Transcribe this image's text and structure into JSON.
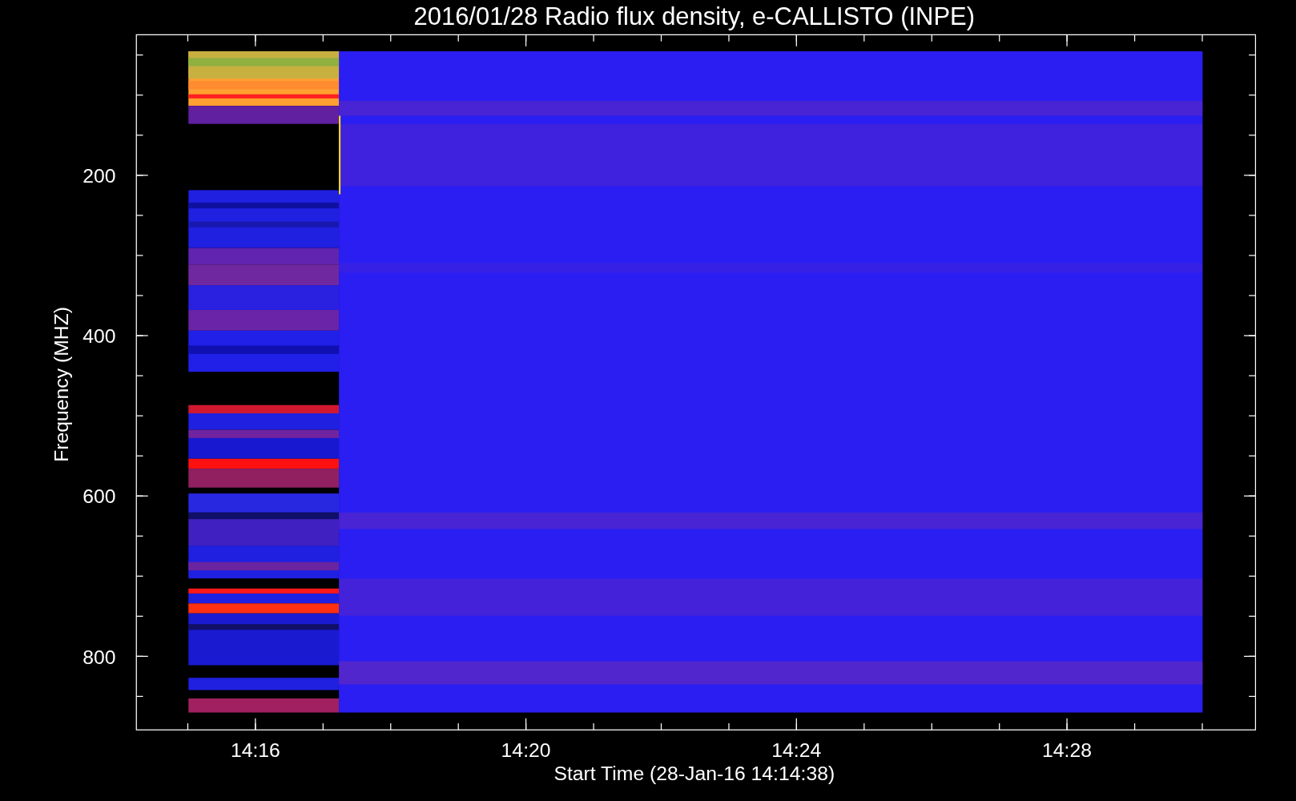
{
  "title": "2016/01/28  Radio flux density, e-CALLISTO (INPE)",
  "y_axis": {
    "label": "Frequency (MHZ)",
    "ticks": [
      "200",
      "400",
      "600",
      "800"
    ]
  },
  "x_axis": {
    "label": "Start Time (28-Jan-16 14:14:38)",
    "ticks": [
      "14:16",
      "14:20",
      "14:24",
      "14:28"
    ]
  }
}
